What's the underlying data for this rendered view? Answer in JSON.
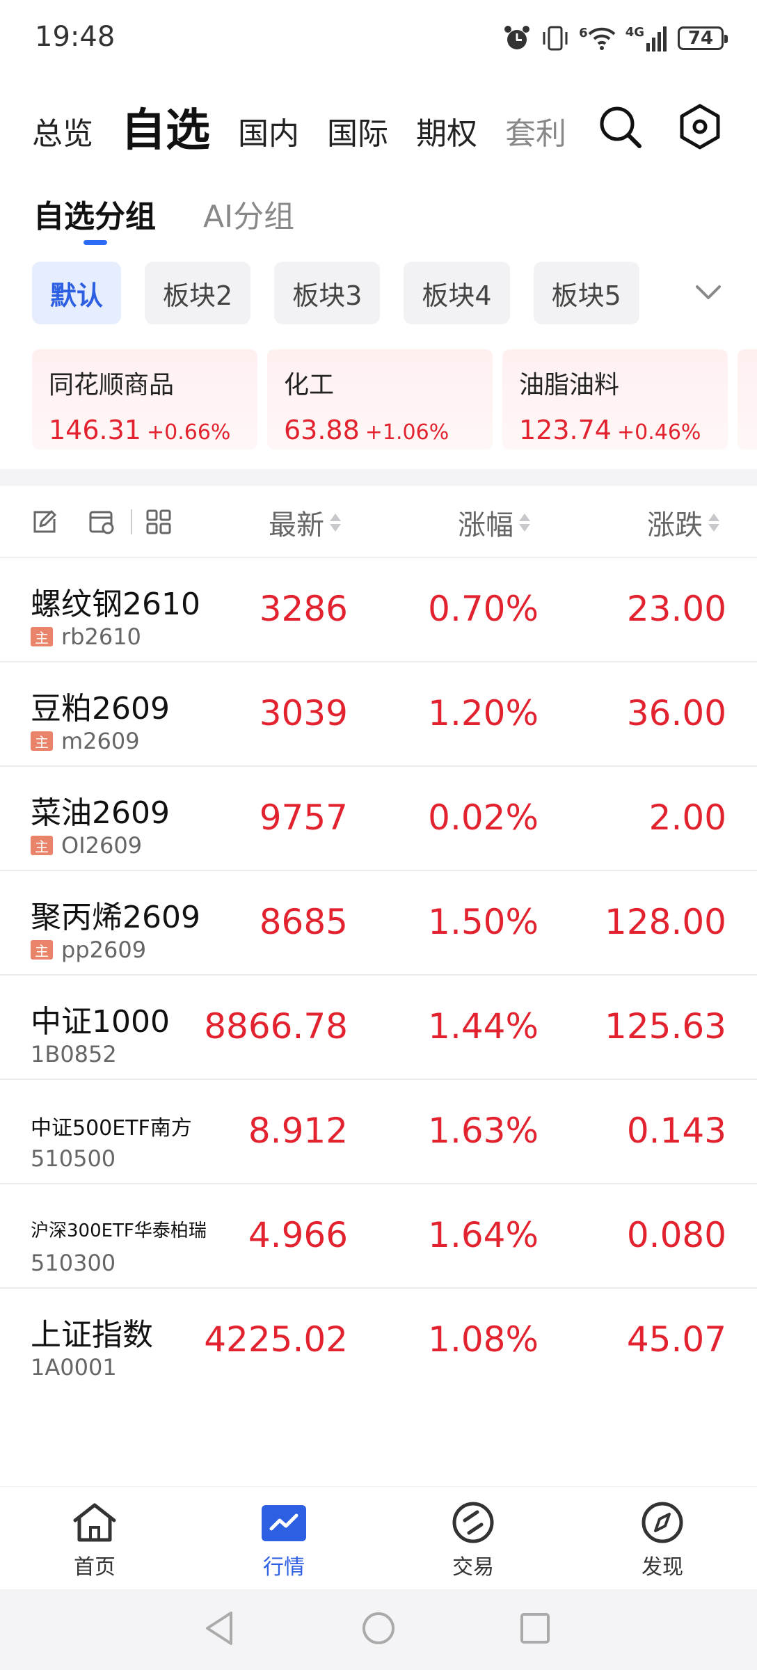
{
  "status_bar": {
    "time": "19:48",
    "signal_label": "4G",
    "wifi_label": "6",
    "battery": "74"
  },
  "top_nav": {
    "tabs": [
      "总览",
      "自选",
      "国内",
      "国际",
      "期权",
      "套利"
    ],
    "active_index": 1
  },
  "sub_tabs": {
    "items": [
      "自选分组",
      "AI分组"
    ],
    "active_index": 0
  },
  "chips": {
    "items": [
      "默认",
      "板块2",
      "板块3",
      "板块4",
      "板块5"
    ],
    "active_index": 0
  },
  "sector_cards": [
    {
      "name": "同花顺商品",
      "value": "146.31",
      "change": "+0.66%"
    },
    {
      "name": "化工",
      "value": "63.88",
      "change": "+1.06%"
    },
    {
      "name": "油脂油料",
      "value": "123.74",
      "change": "+0.46%"
    }
  ],
  "table": {
    "headers": {
      "latest": "最新",
      "pct": "涨幅",
      "chg": "涨跌"
    },
    "main_tag": "主",
    "rows": [
      {
        "name": "螺纹钢2610",
        "code": "rb2610",
        "latest": "3286",
        "pct": "0.70%",
        "chg": "23.00",
        "tag": true
      },
      {
        "name": "豆粕2609",
        "code": "m2609",
        "latest": "3039",
        "pct": "1.20%",
        "chg": "36.00",
        "tag": true
      },
      {
        "name": "菜油2609",
        "code": "OI2609",
        "latest": "9757",
        "pct": "0.02%",
        "chg": "2.00",
        "tag": true
      },
      {
        "name": "聚丙烯2609",
        "code": "pp2609",
        "latest": "8685",
        "pct": "1.50%",
        "chg": "128.00",
        "tag": true
      },
      {
        "name": "中证1000",
        "code": "1B0852",
        "latest": "8866.78",
        "pct": "1.44%",
        "chg": "125.63",
        "tag": false
      },
      {
        "name": "中证500ETF南方",
        "code": "510500",
        "latest": "8.912",
        "pct": "1.63%",
        "chg": "0.143",
        "tag": false
      },
      {
        "name": "沪深300ETF华泰柏瑞",
        "code": "510300",
        "latest": "4.966",
        "pct": "1.64%",
        "chg": "0.080",
        "tag": false
      },
      {
        "name": "上证指数",
        "code": "1A0001",
        "latest": "4225.02",
        "pct": "1.08%",
        "chg": "45.07",
        "tag": false
      }
    ]
  },
  "bottom_nav": {
    "items": [
      "首页",
      "行情",
      "交易",
      "发现"
    ],
    "active_index": 1
  },
  "colors": {
    "up": "#e2232f",
    "accent": "#2d5fe3"
  }
}
